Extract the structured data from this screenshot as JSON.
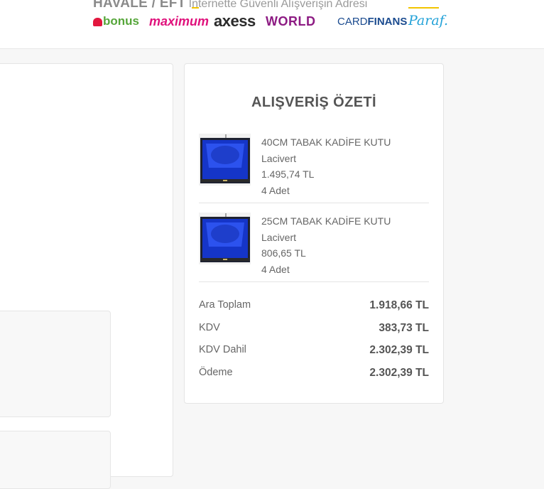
{
  "header": {
    "tagline_bold": "HAVALE / EFT",
    "tagline_text": "Internette Güvenli Alışverişin Adresi",
    "cards": {
      "bonus": "bonus",
      "maximum": "maximum",
      "axess": "axess",
      "world": "WORLD",
      "cardfinans_light": "CARD",
      "cardfinans_bold": "FINANS",
      "paraf": "Paraf."
    }
  },
  "summary": {
    "title": "ALIŞVERİŞ ÖZETİ",
    "items": [
      {
        "name": "40CM TABAK KADİFE KUTU",
        "variant": "Lacivert",
        "price": "1.495,74 TL",
        "qty": "4 Adet"
      },
      {
        "name": "25CM TABAK KADİFE KUTU",
        "variant": "Lacivert",
        "price": "806,65 TL",
        "qty": "4 Adet"
      }
    ],
    "totals": [
      {
        "label": "Ara Toplam",
        "value": "1.918,66 TL"
      },
      {
        "label": "KDV",
        "value": "383,73 TL"
      },
      {
        "label": "KDV Dahil",
        "value": "2.302,39 TL"
      },
      {
        "label": "Ödeme",
        "value": "2.302,39 TL"
      }
    ]
  },
  "colors": {
    "accent_yellow": "#f2c400",
    "product_blue": "#1535c8",
    "box_dark": "#1e2230"
  },
  "icons": [
    "bonus-logo",
    "maximum-logo",
    "axess-logo",
    "world-logo",
    "cardfinans-logo",
    "paraf-logo",
    "product-thumbnail"
  ]
}
